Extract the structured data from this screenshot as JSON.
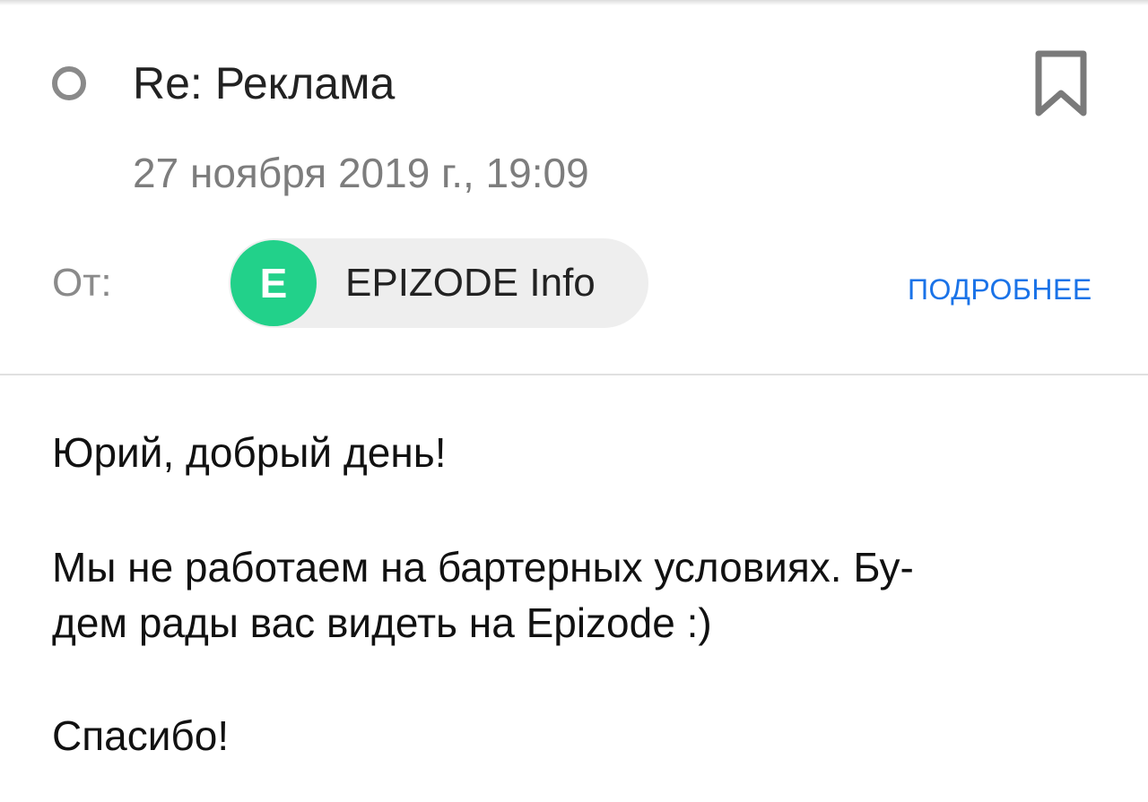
{
  "email": {
    "subject": "Re: Реклама",
    "date": "27 ноября 2019 г., 19:09",
    "from_label": "От:",
    "sender": {
      "avatar_letter": "E",
      "avatar_color": "#22d18a",
      "name": "EPIZODE Info"
    },
    "details_label": "ПОДРОБНЕЕ",
    "body": {
      "greeting": "Юрий, добрый день!",
      "paragraph_line1": "Мы не работаем на бартерных условиях. Бу-",
      "paragraph_line2": "дем рады вас видеть на Epizode :)",
      "signoff": "Спасибо!"
    }
  },
  "icons": {
    "read_indicator": "circle-outline-icon",
    "bookmark": "bookmark-icon"
  },
  "colors": {
    "link": "#1a73e8",
    "chip_background": "#eeeeee",
    "muted_text": "#7d7d7d"
  }
}
